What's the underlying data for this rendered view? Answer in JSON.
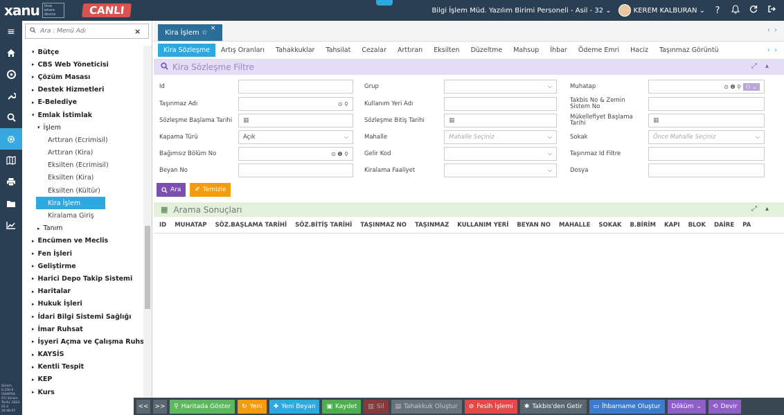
{
  "header": {
    "logo_text": "xanu",
    "logo_sub": "time where device",
    "env_badge": "CANLI",
    "user_role": "Bilgi İşlem Müd. Yazılım Birimi Personeli - Asil - 32 ⌄",
    "user_name": "KEREM KALBURAN ⌄",
    "help": "?"
  },
  "rail": {
    "footer": "Sürüm 6.330.0 (SHAP54-07) Sürüm Tarihi: 2022-01-2 16:48:07"
  },
  "menu": {
    "search_placeholder": "Ara : Menü Adı",
    "items": [
      {
        "label": "Bütçe",
        "level": 0,
        "arrow": "▾"
      },
      {
        "label": "CBS Web Yöneticisi",
        "level": 0,
        "arrow": "▸"
      },
      {
        "label": "Çözüm Masası",
        "level": 0,
        "arrow": "▸"
      },
      {
        "label": "Destek Hizmetleri",
        "level": 0,
        "arrow": "▸"
      },
      {
        "label": "E-Belediye",
        "level": 0,
        "arrow": "▸"
      },
      {
        "label": "Emlak İstimlak",
        "level": 0,
        "arrow": "▾"
      },
      {
        "label": "İşlem",
        "level": 1,
        "arrow": "▾"
      },
      {
        "label": "Arttıran (Ecrimisil)",
        "level": 2,
        "arrow": ""
      },
      {
        "label": "Arttıran (Kira)",
        "level": 2,
        "arrow": ""
      },
      {
        "label": "Eksilten (Ecrimisil)",
        "level": 2,
        "arrow": ""
      },
      {
        "label": "Eksilten (Kira)",
        "level": 2,
        "arrow": ""
      },
      {
        "label": "Eksilten (Kültür)",
        "level": 2,
        "arrow": ""
      },
      {
        "label": "Kira İşlem",
        "level": 2,
        "arrow": "",
        "selected": true
      },
      {
        "label": "Kiralama Giriş",
        "level": 2,
        "arrow": ""
      },
      {
        "label": "Tanım",
        "level": 1,
        "arrow": "▸"
      },
      {
        "label": "Encümen ve Meclis",
        "level": 0,
        "arrow": "▸"
      },
      {
        "label": "Fen İşleri",
        "level": 0,
        "arrow": "▸"
      },
      {
        "label": "Geliştirme",
        "level": 0,
        "arrow": "▸"
      },
      {
        "label": "Harici Depo Takip Sistemi",
        "level": 0,
        "arrow": "▸"
      },
      {
        "label": "Haritalar",
        "level": 0,
        "arrow": "▸"
      },
      {
        "label": "Hukuk İşleri",
        "level": 0,
        "arrow": "▸"
      },
      {
        "label": "İdari Bilgi Sistemi Sağlığı",
        "level": 0,
        "arrow": "▸"
      },
      {
        "label": "İmar Ruhsat",
        "level": 0,
        "arrow": "▸"
      },
      {
        "label": "İşyeri Açma ve Çalışma Ruhsat T",
        "level": 0,
        "arrow": "▸"
      },
      {
        "label": "KAYSİS",
        "level": 0,
        "arrow": "▸"
      },
      {
        "label": "Kentli Tespit",
        "level": 0,
        "arrow": "▸"
      },
      {
        "label": "KEP",
        "level": 0,
        "arrow": "▸"
      },
      {
        "label": "Kurs",
        "level": 0,
        "arrow": "▸"
      }
    ]
  },
  "page_tab": {
    "label": "Kira İşlem ☆",
    "close": "×"
  },
  "subtabs": [
    "Kira Sözleşme",
    "Artış Oranları",
    "Tahakkuklar",
    "Tahsilat",
    "Cezalar",
    "Arttıran",
    "Eksilten",
    "Düzeltme",
    "Mahsup",
    "İhbar",
    "Ödeme Emri",
    "Haciz",
    "Taşınmaz Görüntü"
  ],
  "filter": {
    "title": "Kira Sözleşme Filtre",
    "labels": {
      "id": "Id",
      "grup": "Grup",
      "muhatap": "Muhatap",
      "tasinmaz_adi": "Taşınmaz Adı",
      "kullanim_yeri_adi": "Kullanım Yeri Adı",
      "takbis": "Takbis No & Zemin Sistem No",
      "soz_bas": "Sözleşme Başlama Tarihi",
      "soz_bit": "Sözleşme Bitiş Tarihi",
      "mukellefiyet": "Mükellefiyet Başlama Tarihi",
      "kapama_turu": "Kapama Türü",
      "mahalle": "Mahalle",
      "sokak": "Sokak",
      "bagimsiz_bolum": "Bağımsız Bölüm No",
      "gelir_kod": "Gelir Kod",
      "tasinmaz_id": "Taşınmaz Id Filtre",
      "beyan_no": "Beyan No",
      "kiralama_faaliyet": "Kiralama Faaliyet",
      "dosya": "Dosya"
    },
    "values": {
      "kapama_turu": "Açık",
      "mahalle_placeholder": "Mahalle Seçiniz",
      "sokak_placeholder": "Önce Mahalle Seçiniz"
    },
    "search_button": "Ara",
    "clear_button": "Temizle"
  },
  "results": {
    "title": "Arama Sonuçları",
    "columns": [
      "ID",
      "MUHATAP",
      "SÖZ.BAŞLAMA TARİHİ",
      "SÖZ.BİTİŞ TARİHİ",
      "TAŞINMAZ NO",
      "TAŞINMAZ",
      "KULLANIM YERİ",
      "BEYAN NO",
      "MAHALLE",
      "SOKAK",
      "B.BİRİM",
      "KAPI",
      "BLOK",
      "DAİRE",
      "PA"
    ]
  },
  "bottom": {
    "prev": "<<",
    "next": ">>",
    "harita": "Haritada Göster",
    "yeni": "Yeni",
    "yeni_beyan": "Yeni Beyan",
    "kaydet": "Kaydet",
    "sil": "Sil",
    "tahakkuk": "Tahakkuk Oluştur",
    "fesih": "Fesih İşlemi",
    "takbis": "Takbis'den Getir",
    "ihbarname": "İhbarname Oluştur",
    "dokum": "Döküm",
    "devir": "Devir"
  }
}
